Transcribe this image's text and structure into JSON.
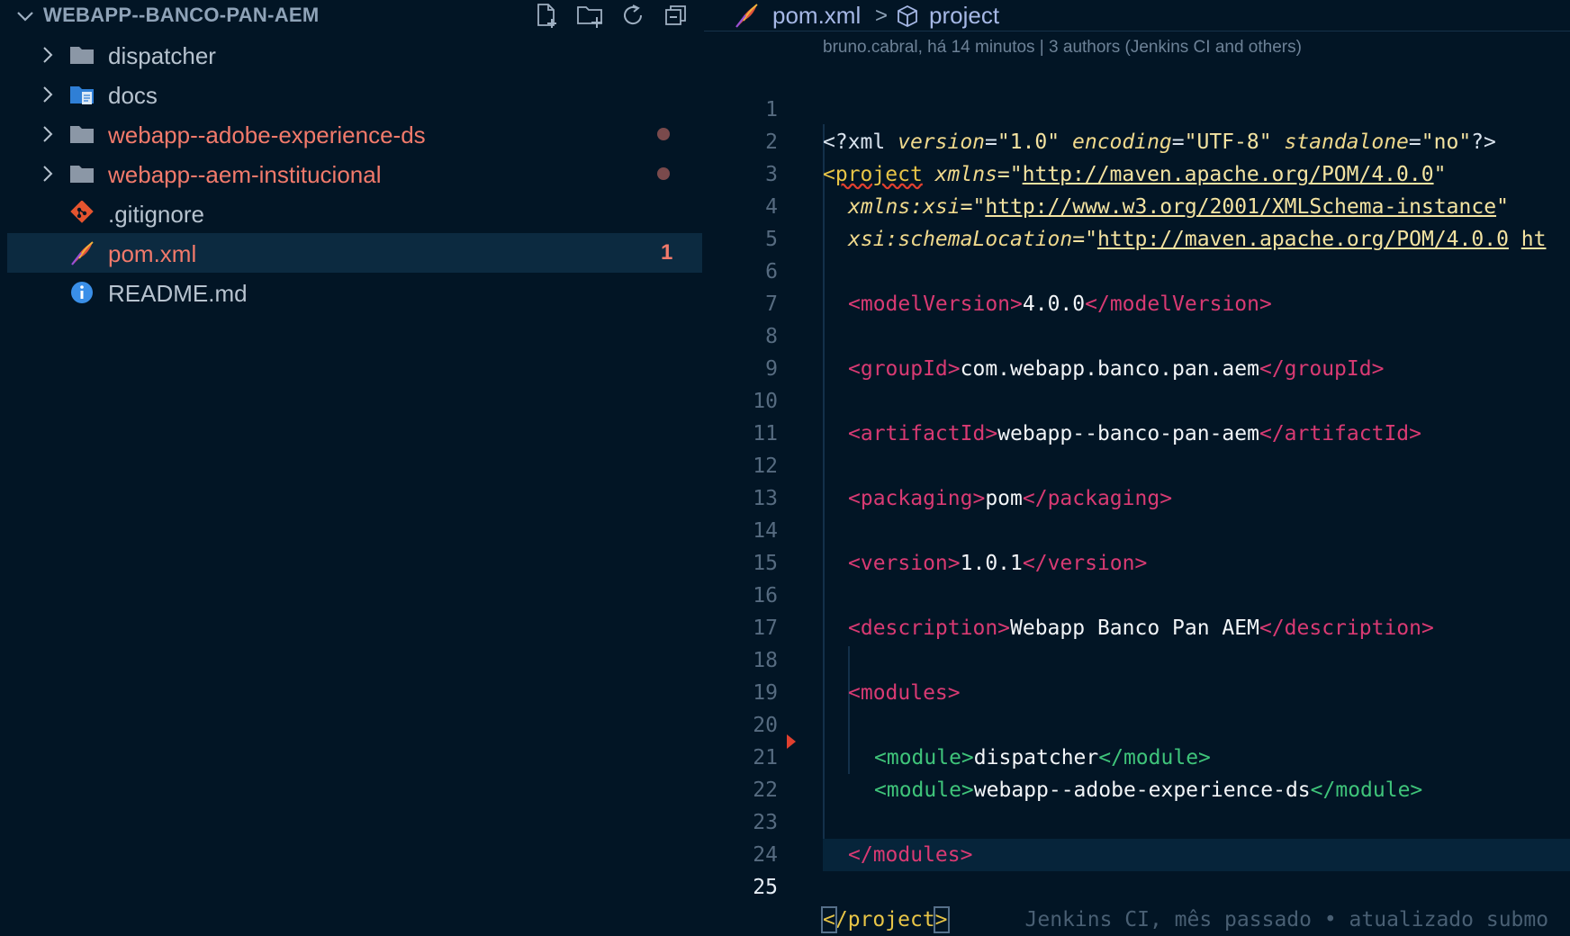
{
  "explorer": {
    "title": "WEBAPP--BANCO-PAN-AEM",
    "actions": [
      "new-file-icon",
      "new-folder-icon",
      "refresh-icon",
      "collapse-all-icon"
    ],
    "items": [
      {
        "name": "dispatcher",
        "kind": "folder",
        "status": ""
      },
      {
        "name": "docs",
        "kind": "folder-docs",
        "status": ""
      },
      {
        "name": "webapp--adobe-experience-ds",
        "kind": "folder",
        "status": "modified"
      },
      {
        "name": "webapp--aem-institucional",
        "kind": "folder",
        "status": "modified"
      },
      {
        "name": ".gitignore",
        "kind": "git-file",
        "status": ""
      },
      {
        "name": "pom.xml",
        "kind": "xml-file",
        "status": "error",
        "badge": "1"
      },
      {
        "name": "README.md",
        "kind": "info-file",
        "status": ""
      }
    ]
  },
  "editor": {
    "breadcrumb": {
      "file": "pom.xml",
      "separator": ">",
      "symbol": "project"
    },
    "blame": "bruno.cabral, há 14 minutos | 3 authors (Jenkins CI and others)",
    "line_numbers": [
      "1",
      "2",
      "3",
      "4",
      "5",
      "6",
      "7",
      "8",
      "9",
      "10",
      "11",
      "12",
      "13",
      "14",
      "15",
      "16",
      "17",
      "18",
      "19",
      "20",
      "21",
      "22",
      "23",
      "24",
      "25"
    ],
    "current_line": "25",
    "code": {
      "l1": {
        "open": "<?xml ",
        "a1": "version",
        "eq": "=",
        "v1": "\"1.0\"",
        "a2": "encoding",
        "v2": "\"UTF-8\"",
        "a3": "standalone",
        "v3": "\"no\"",
        "close": "?>"
      },
      "l2": {
        "lt": "<",
        "tag": "project",
        "attr": "xmlns",
        "q1": "=\"",
        "url": "http://maven.apache.org/POM/4.0.0",
        "q2": "\""
      },
      "l3": {
        "attr": "xmlns:xsi",
        "q1": "=\"",
        "url": "http://www.w3.org/2001/XMLSchema-instance",
        "q2": "\""
      },
      "l4": {
        "attr": "xsi:schemaLocation",
        "q1": "=\"",
        "url": "http://maven.apache.org/POM/4.0.0",
        "tail": "ht"
      },
      "l6": {
        "otag": "<modelVersion>",
        "text": "4.0.0",
        "ctag": "</modelVersion>"
      },
      "l8": {
        "otag": "<groupId>",
        "text": "com.webapp.banco.pan.aem",
        "ctag": "</groupId>"
      },
      "l10": {
        "otag": "<artifactId>",
        "text": "webapp--banco-pan-aem",
        "ctag": "</artifactId>"
      },
      "l12": {
        "otag": "<packaging>",
        "text": "pom",
        "ctag": "</packaging>"
      },
      "l14": {
        "otag": "<version>",
        "text": "1.0.1",
        "ctag": "</version>"
      },
      "l16": {
        "otag": "<description>",
        "text": "Webapp Banco Pan AEM",
        "ctag": "</description>"
      },
      "l18": {
        "otag": "<modules>"
      },
      "l20": {
        "otag": "<module>",
        "text": "dispatcher",
        "ctag": "</module>"
      },
      "l21": {
        "otag": "<module>",
        "text": "webapp--adobe-experience-ds",
        "ctag": "</module>"
      },
      "l23": {
        "ctag": "</modules>"
      },
      "l25": {
        "lt": "<",
        "tag": "/project",
        "gt": ">",
        "ghost": "Jenkins CI, mês passado • atualizado submo"
      }
    }
  },
  "colors": {
    "background": "#021525",
    "selection": "#0c2a40",
    "modified": "#f27a6b",
    "tag": "#d93a73",
    "module_tag": "#3fc47a"
  }
}
